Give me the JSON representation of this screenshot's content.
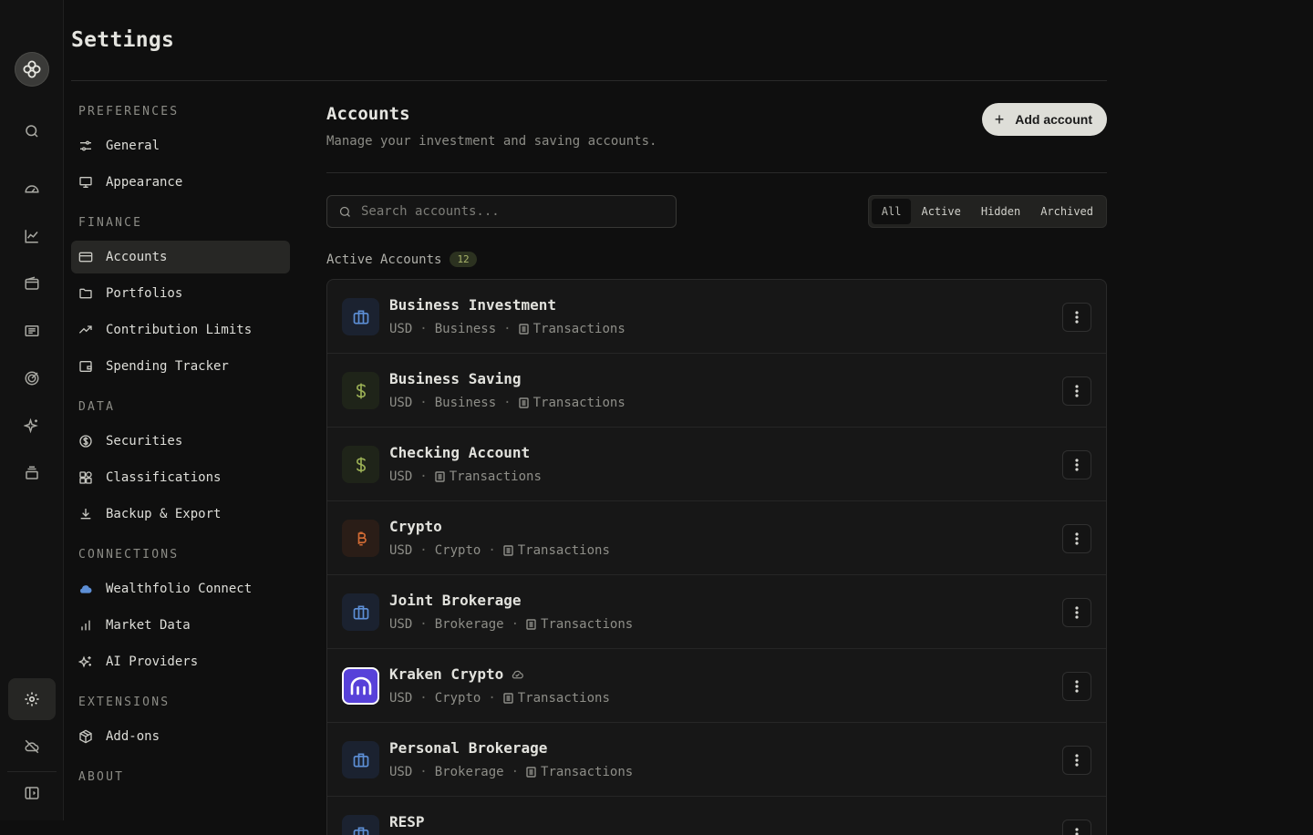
{
  "header": {
    "title": "Settings"
  },
  "rail": {
    "items": [
      "search-icon",
      "dashboard-icon",
      "performance-icon",
      "wallet-icon",
      "activity-icon",
      "goals-icon",
      "ai-icon",
      "stack-icon",
      "settings-icon",
      "offline-icon",
      "sidebar-toggle-icon"
    ]
  },
  "nav": {
    "sections": [
      {
        "title": "PREFERENCES",
        "items": [
          {
            "label": "General",
            "icon": "sliders-icon"
          },
          {
            "label": "Appearance",
            "icon": "monitor-icon"
          }
        ]
      },
      {
        "title": "FINANCE",
        "items": [
          {
            "label": "Accounts",
            "icon": "card-icon",
            "active": true
          },
          {
            "label": "Portfolios",
            "icon": "folder-icon"
          },
          {
            "label": "Contribution Limits",
            "icon": "trend-icon"
          },
          {
            "label": "Spending Tracker",
            "icon": "receipt-wallet-icon"
          }
        ]
      },
      {
        "title": "DATA",
        "items": [
          {
            "label": "Securities",
            "icon": "dollar-circle-icon"
          },
          {
            "label": "Classifications",
            "icon": "shapes-icon"
          },
          {
            "label": "Backup & Export",
            "icon": "download-icon"
          }
        ]
      },
      {
        "title": "CONNECTIONS",
        "items": [
          {
            "label": "Wealthfolio Connect",
            "icon": "cloud-sync-icon"
          },
          {
            "label": "Market Data",
            "icon": "bar-chart-icon"
          },
          {
            "label": "AI Providers",
            "icon": "sparkles-icon"
          }
        ]
      },
      {
        "title": "EXTENSIONS",
        "items": [
          {
            "label": "Add-ons",
            "icon": "package-icon"
          }
        ]
      },
      {
        "title": "ABOUT",
        "items": []
      }
    ]
  },
  "main": {
    "title": "Accounts",
    "subtitle": "Manage your investment and saving accounts.",
    "add_label": "Add account",
    "search_placeholder": "Search accounts...",
    "filters": [
      "All",
      "Active",
      "Hidden",
      "Archived"
    ],
    "active_filter": "All",
    "list_title": "Active Accounts",
    "list_count": "12",
    "accounts": [
      {
        "name": "Business Investment",
        "currency": "USD",
        "group": "Business",
        "tx": "Transactions",
        "icon": "briefcase-icon"
      },
      {
        "name": "Business Saving",
        "currency": "USD",
        "group": "Business",
        "tx": "Transactions",
        "icon": "dollar-icon"
      },
      {
        "name": "Checking Account",
        "currency": "USD",
        "group": "",
        "tx": "Transactions",
        "icon": "dollar-icon"
      },
      {
        "name": "Crypto",
        "currency": "USD",
        "group": "Crypto",
        "tx": "Transactions",
        "icon": "bitcoin-icon"
      },
      {
        "name": "Joint Brokerage",
        "currency": "USD",
        "group": "Brokerage",
        "tx": "Transactions",
        "icon": "briefcase-icon"
      },
      {
        "name": "Kraken Crypto",
        "currency": "USD",
        "group": "Crypto",
        "tx": "Transactions",
        "icon": "kraken-logo-icon",
        "synced": true
      },
      {
        "name": "Personal Brokerage",
        "currency": "USD",
        "group": "Brokerage",
        "tx": "Transactions",
        "icon": "briefcase-icon"
      },
      {
        "name": "RESP",
        "currency": "",
        "group": "",
        "tx": "",
        "icon": "briefcase-icon"
      }
    ]
  }
}
